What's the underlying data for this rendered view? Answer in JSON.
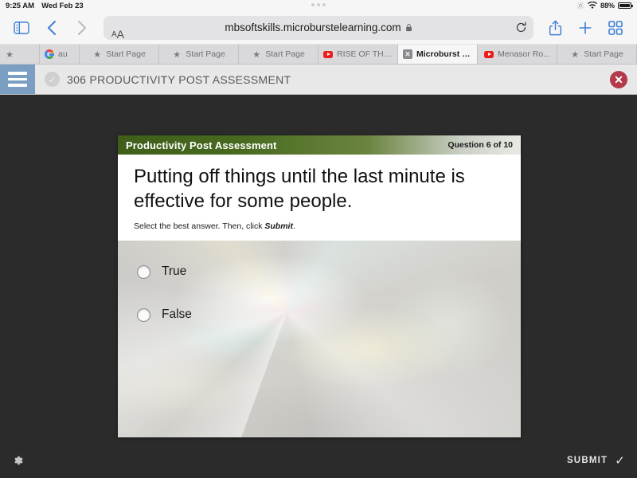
{
  "status_bar": {
    "time": "9:25 AM",
    "date": "Wed Feb 23",
    "battery_percent": "88%",
    "wifi_icon": "wifi-icon",
    "brightness_icon": "brightness-icon",
    "battery_icon": "battery-icon"
  },
  "browser": {
    "sidebar_icon": "sidebar-icon",
    "back_icon": "chevron-left-icon",
    "forward_icon": "chevron-right-icon",
    "text_size_label_big": "A",
    "text_size_label_small": "A",
    "url": "mbsoftskills.microburstelearning.com",
    "lock_icon": "lock-icon",
    "reload_icon": "reload-icon",
    "share_icon": "share-icon",
    "new_tab_icon": "plus-icon",
    "tab_overview_icon": "grid-icon",
    "tabs": [
      {
        "label": "au",
        "favicon": "google-icon",
        "active": false,
        "first": true
      },
      {
        "label": "Start Page",
        "favicon": "star-icon",
        "active": false
      },
      {
        "label": "Start Page",
        "favicon": "star-icon",
        "active": false
      },
      {
        "label": "Start Page",
        "favicon": "star-icon",
        "active": false
      },
      {
        "label": "RISE OF THE...",
        "favicon": "youtube-icon",
        "active": false
      },
      {
        "label": "Microburst L...",
        "favicon": "close-icon",
        "active": true
      },
      {
        "label": "Menasor Ro...",
        "favicon": "youtube-icon",
        "active": false
      },
      {
        "label": "Start Page",
        "favicon": "star-icon",
        "active": false
      }
    ]
  },
  "app_header": {
    "menu_icon": "hamburger-icon",
    "status_icon": "check-circle-icon",
    "course_title": "306 PRODUCTIVITY POST ASSESSMENT",
    "close_icon": "close-circle-icon",
    "accent_color": "#7b9fc2",
    "close_color": "#b33a4a"
  },
  "slide": {
    "header_title": "Productivity Post Assessment",
    "question_counter": "Question 6 of 10",
    "header_color": "#486a1f",
    "question_text": "Putting off things until the last minute is effective for some people.",
    "instruction_prefix": "Select the best answer. Then, click ",
    "instruction_emphasis": "Submit",
    "instruction_suffix": ".",
    "options": [
      {
        "label": "True",
        "selected": false
      },
      {
        "label": "False",
        "selected": false
      }
    ]
  },
  "bottom_bar": {
    "settings_icon": "gear-icon",
    "submit_label": "SUBMIT",
    "submit_check_icon": "check-icon"
  }
}
